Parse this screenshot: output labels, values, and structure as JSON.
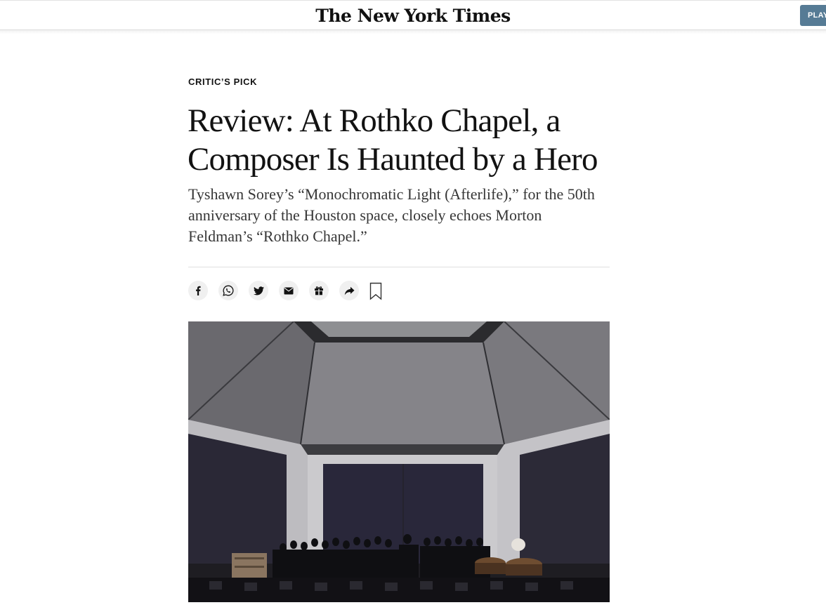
{
  "header": {
    "masthead": "The New York Times",
    "play_button": "PLAY"
  },
  "article": {
    "kicker": "CRITIC’S PICK",
    "headline": "Review: At Rothko Chapel, a Composer Is Haunted by a Hero",
    "summary": "Tyshawn Sorey’s “Monochromatic Light (Afterlife),” for the 50th anniversary of the Houston space, closely echoes Morton Feldman’s “Rothko Chapel.”"
  },
  "share_tools": [
    {
      "icon": "facebook-icon"
    },
    {
      "icon": "whatsapp-icon"
    },
    {
      "icon": "twitter-icon"
    },
    {
      "icon": "email-icon"
    },
    {
      "icon": "gift-icon"
    },
    {
      "icon": "share-icon"
    },
    {
      "icon": "bookmark-icon"
    }
  ],
  "colors": {
    "play_button": "#567b95",
    "share_button_bg": "#f0f0f0",
    "text": "#121212"
  }
}
